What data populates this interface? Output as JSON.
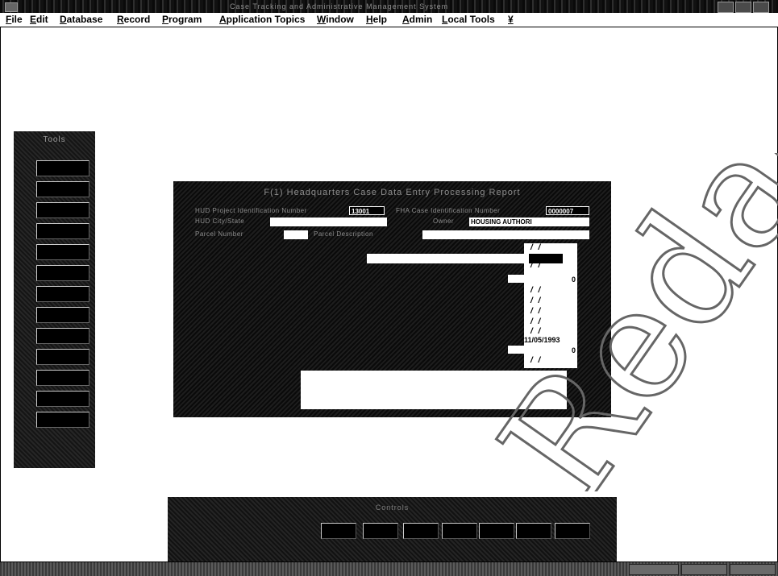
{
  "window": {
    "title": "Case Tracking and Administrative Management System"
  },
  "menu": {
    "items": [
      "File",
      "Edit",
      "Database",
      "Record",
      "Program",
      "Application Topics",
      "Window",
      "Help",
      "Admin",
      "Local Tools",
      "¥"
    ]
  },
  "tools_palette": {
    "caption": "Tools"
  },
  "dialog": {
    "title": "F(1) Headquarters Case Data Entry Processing Report",
    "labels": {
      "project_id": "HUD Project Identification Number",
      "case_id": "FHA Case Identification Number",
      "city_state": "HUD City/State",
      "owner": "Owner",
      "parcel": "Parcel Number",
      "parcel_desc": "Parcel Description"
    },
    "values": {
      "project_id": "13001",
      "case_id": "0000007",
      "city_state": "",
      "owner": "HOUSING AUTHORI",
      "parcel": "",
      "parcel_desc": ""
    },
    "date_column": {
      "slash_placeholder": "/ /",
      "date_value": "11/05/1993",
      "zero_values": [
        "0",
        "0"
      ]
    }
  },
  "bottom_toolbar": {
    "caption": "Controls"
  },
  "watermark": {
    "text": "Redacted"
  }
}
